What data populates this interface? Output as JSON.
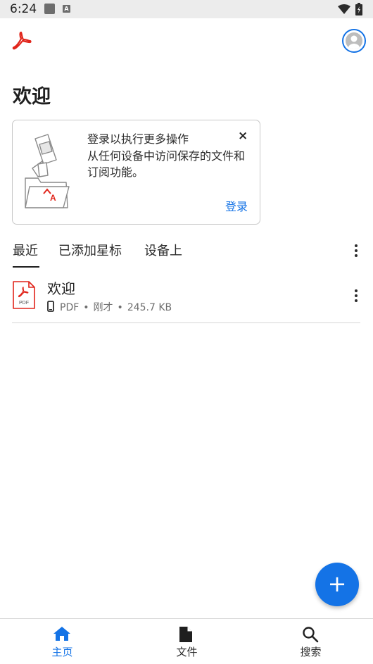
{
  "status_bar": {
    "time": "6:24"
  },
  "header": {
    "title": "欢迎"
  },
  "signin_card": {
    "message_line1": "登录以执行更多操作",
    "message_line2": "从任何设备中访问保存的文件和",
    "message_line3": "订阅功能。",
    "close_label": "×",
    "signin_label": "登录",
    "illustration_text": "A"
  },
  "tabs": [
    {
      "label": "最近",
      "active": true
    },
    {
      "label": "已添加星标",
      "active": false
    },
    {
      "label": "设备上",
      "active": false
    }
  ],
  "files": [
    {
      "name": "欢迎",
      "type": "PDF",
      "time": "刚才",
      "size": "245.7 KB",
      "icon_text": "PDF"
    }
  ],
  "fab": {
    "label": "+"
  },
  "bottom_nav": [
    {
      "label": "主页",
      "icon": "home-icon",
      "active": true
    },
    {
      "label": "文件",
      "icon": "file-icon",
      "active": false
    },
    {
      "label": "搜索",
      "icon": "search-icon",
      "active": false
    }
  ],
  "colors": {
    "accent": "#1473e6",
    "brand_red": "#e1251b"
  }
}
